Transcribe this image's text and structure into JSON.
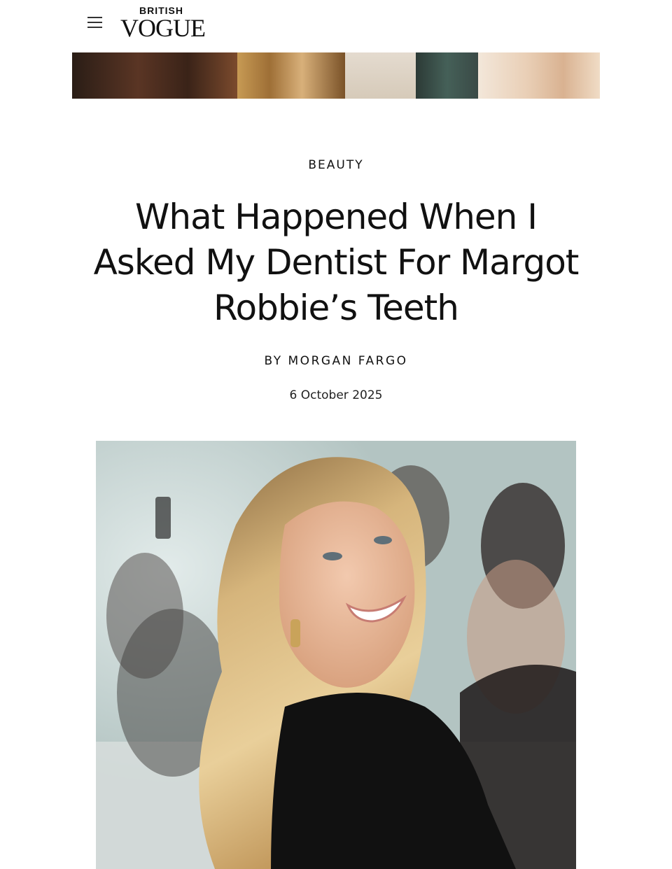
{
  "header": {
    "logo_top": "BRITISH",
    "logo_main": "VOGUE",
    "menu_icon": "hamburger-menu-icon"
  },
  "article": {
    "category": "BEAUTY",
    "title": "What Happened When I Asked My Dentist For Margot Robbie’s Teeth",
    "byline_prefix": "BY",
    "author": "MORGAN FARGO",
    "date": "6 October 2025"
  },
  "colors": {
    "text": "#111111",
    "background": "#ffffff"
  }
}
